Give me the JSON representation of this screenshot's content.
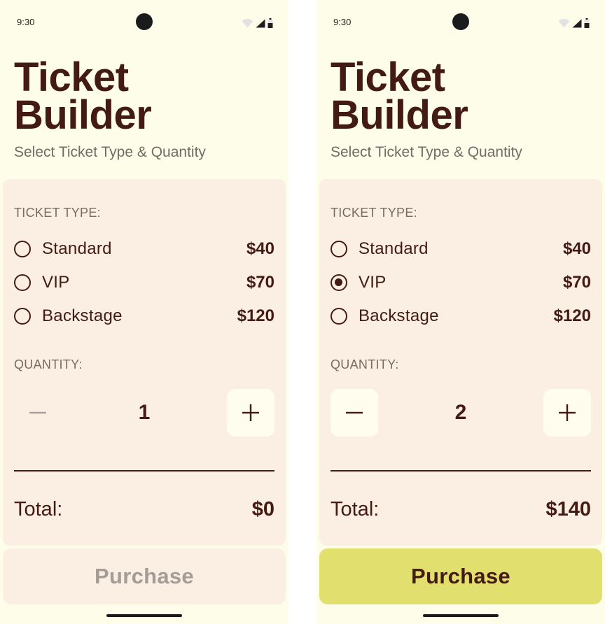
{
  "colors": {
    "background": "#fefde9",
    "card": "#fbefe3",
    "ink": "#431a14",
    "muted": "#746b66",
    "accent": "#e1e06f",
    "disabled_text": "#a59c98"
  },
  "screens": [
    {
      "status": {
        "time": "9:30",
        "icons": [
          "wifi-icon",
          "signal-icon",
          "battery-icon"
        ]
      },
      "title_line1": "Ticket",
      "title_line2": "Builder",
      "subtitle": "Select Ticket Type & Quantity",
      "ticket_type_label": "TICKET TYPE:",
      "options": [
        {
          "name": "Standard",
          "price": "$40",
          "selected": false
        },
        {
          "name": "VIP",
          "price": "$70",
          "selected": false
        },
        {
          "name": "Backstage",
          "price": "$120",
          "selected": false
        }
      ],
      "quantity_label": "QUANTITY:",
      "quantity": "1",
      "minus_enabled": false,
      "plus_enabled": true,
      "total_label": "Total:",
      "total_value": "$0",
      "purchase_label": "Purchase",
      "purchase_enabled": false
    },
    {
      "status": {
        "time": "9:30",
        "icons": [
          "wifi-icon",
          "signal-icon",
          "battery-icon"
        ]
      },
      "title_line1": "Ticket",
      "title_line2": "Builder",
      "subtitle": "Select Ticket Type & Quantity",
      "ticket_type_label": "TICKET TYPE:",
      "options": [
        {
          "name": "Standard",
          "price": "$40",
          "selected": false
        },
        {
          "name": "VIP",
          "price": "$70",
          "selected": true
        },
        {
          "name": "Backstage",
          "price": "$120",
          "selected": false
        }
      ],
      "quantity_label": "QUANTITY:",
      "quantity": "2",
      "minus_enabled": true,
      "plus_enabled": true,
      "total_label": "Total:",
      "total_value": "$140",
      "purchase_label": "Purchase",
      "purchase_enabled": true
    }
  ]
}
